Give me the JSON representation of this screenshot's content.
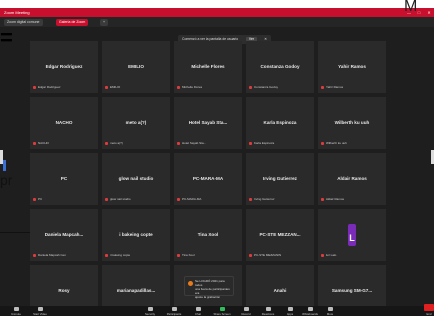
{
  "window": {
    "title": "Zoom Meeting",
    "controls": [
      "—",
      "□",
      "✕"
    ]
  },
  "tabs": [
    {
      "label": "Zoom digital comune",
      "active": false
    },
    {
      "label": "Galería de Zoom",
      "active": true
    },
    {
      "label": "+",
      "active": false
    }
  ],
  "share_banner": {
    "text": "Comenzó a ver la pantalla de usuario",
    "button": "Ver",
    "close": "✕"
  },
  "participants": [
    {
      "name": "Edgar Rodriguez",
      "label": "Edgar Rodriguez"
    },
    {
      "name": "EMILIO",
      "label": "EMILIO"
    },
    {
      "name": "Michelle Flores",
      "label": "Michelle Flores"
    },
    {
      "name": "Constanza Godoy",
      "label": "Constanza Godoy"
    },
    {
      "name": "Yahir Ramos",
      "label": "Yahir Ramos"
    },
    {
      "name": "NACHO",
      "label": "NACHO"
    },
    {
      "name": "meto a(?)",
      "label": "meto a(?)"
    },
    {
      "name": "Hotel Sayab Sta...",
      "label": "Hotel Sayab Sta..."
    },
    {
      "name": "Karla Espinoza",
      "label": "Karla Espinoza"
    },
    {
      "name": "Wilberth ku uuh",
      "label": "Wilberth ku uuh"
    },
    {
      "name": "PC",
      "label": "PC"
    },
    {
      "name": "glow nail studio",
      "label": "glow nail studio"
    },
    {
      "name": "PC-MARA-MA",
      "label": "PC-MARA-MA"
    },
    {
      "name": "Irving Gutierrez",
      "label": "Irving Gutierrez"
    },
    {
      "name": "Aldair Ramos",
      "label": "Aldair Ramos"
    },
    {
      "name": "Daniela Mapcah...",
      "label": "Daniela Mapcah Cen"
    },
    {
      "name": "i bakeing copte",
      "label": "i bakeing copte"
    },
    {
      "name": "Tina Xool",
      "label": "Tina Xool"
    },
    {
      "name": "PC-STE MEZZAN...",
      "label": "PC-STE MEZZANIN"
    },
    {
      "name": "",
      "label": "luz Lalo",
      "avatar": "L"
    },
    {
      "name": "Rosy",
      "label": "Rosy"
    },
    {
      "name": "marianapadillas...",
      "label": "marianapadillaestilista"
    },
    {
      "name": "ame m...",
      "label": ""
    },
    {
      "name": "Anahi",
      "label": "Anahi"
    },
    {
      "name": "Samsung SM-G7...",
      "label": "Samsung SM-G7..."
    }
  ],
  "notification": {
    "title": "Se LOGRÓ 2021 para todos",
    "body": "una fuera de participantes era",
    "extra": "ajuste la grabación"
  },
  "toolbar": [
    {
      "label": "Unmute",
      "icon": "mic-icon"
    },
    {
      "label": "Start Video",
      "icon": "video-icon"
    },
    {
      "label": "Security",
      "icon": "shield-icon"
    },
    {
      "label": "Participants",
      "icon": "participants-icon"
    },
    {
      "label": "Chat",
      "icon": "chat-icon"
    },
    {
      "label": "Share Screen",
      "icon": "share-icon"
    },
    {
      "label": "Record",
      "icon": "record-icon"
    },
    {
      "label": "Reactions",
      "icon": "reactions-icon"
    },
    {
      "label": "Apps",
      "icon": "apps-icon"
    },
    {
      "label": "Whiteboards",
      "icon": "whiteboard-icon"
    },
    {
      "label": "More",
      "icon": "more-icon"
    },
    {
      "label": "End",
      "icon": "end-icon"
    }
  ],
  "overlay": {
    "letter_m": "M",
    "equals": "=",
    "p_text": "pr"
  },
  "colors": {
    "accent": "#c8102e",
    "tile": "#2a2a2a",
    "background": "#1e1e1e",
    "avatar": "#7a2bb8",
    "share": "#2fbf5a",
    "end": "#d9342b"
  }
}
